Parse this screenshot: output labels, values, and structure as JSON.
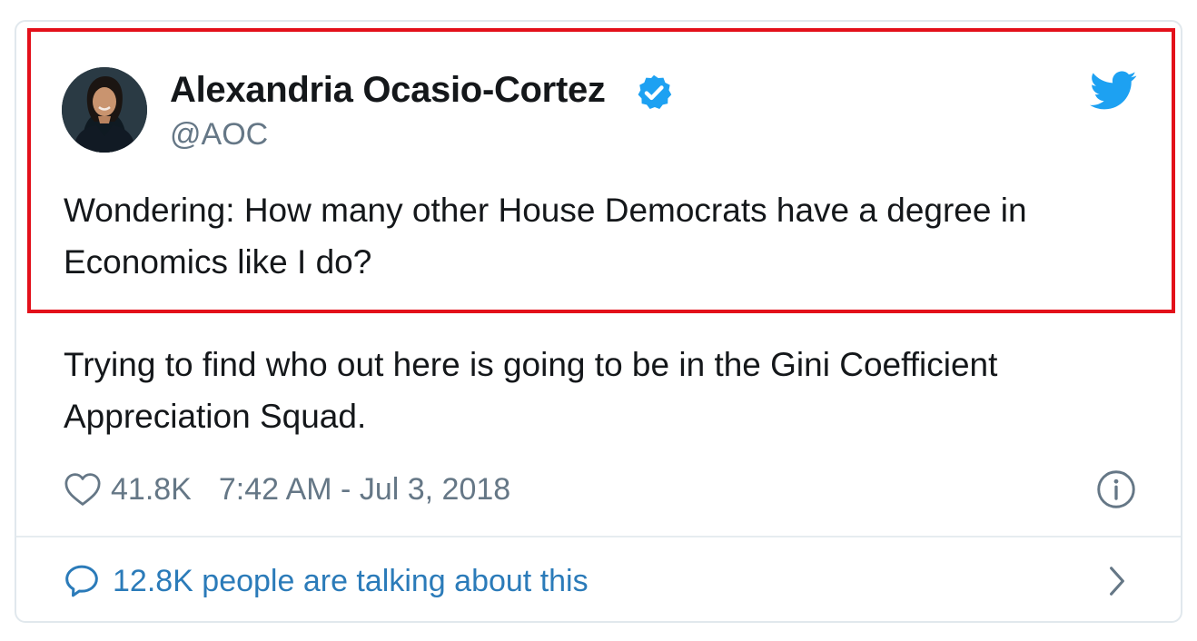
{
  "author": {
    "display_name": "Alexandria Ocasio-Cortez",
    "handle": "@AOC",
    "verified": true,
    "avatar_icon": "profile-photo"
  },
  "tweet": {
    "text_highlighted": "Wondering: How many other House Democrats have a degree in Economics like I do?",
    "text_continued": "Trying to find who out here is going to be in the Gini Coefficient Appreciation Squad."
  },
  "meta": {
    "like_count": "41.8K",
    "timestamp": "7:42 AM - Jul 3, 2018"
  },
  "footer": {
    "talking_text": "12.8K people are talking about this"
  },
  "icons": {
    "verified": "verified-badge-icon",
    "brand": "twitter-bird-icon",
    "like": "heart-icon",
    "info": "info-icon",
    "reply": "speech-bubble-icon",
    "more": "chevron-right-icon"
  },
  "colors": {
    "twitter_blue": "#1da1f2",
    "link_blue": "#2b7bb9",
    "text_primary": "#14171a",
    "text_secondary": "#657786",
    "highlight_red": "#e3101a",
    "border": "#e1e8ed"
  }
}
